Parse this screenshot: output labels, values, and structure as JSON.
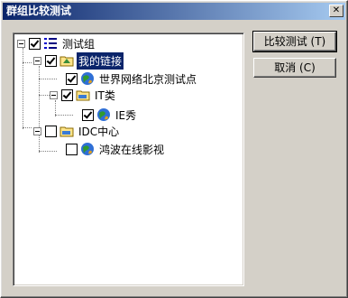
{
  "window": {
    "title": "群组比较测试",
    "close_glyph": "✕"
  },
  "tree": {
    "root": {
      "label": "测试组",
      "checked": true,
      "partial": true
    },
    "group1": {
      "label": "我的链接",
      "checked": true,
      "selected": true
    },
    "item1": {
      "label": "世界网络北京测试点",
      "checked": true
    },
    "group2": {
      "label": "IT类",
      "checked": true
    },
    "item2": {
      "label": "IE秀",
      "checked": true
    },
    "group3": {
      "label": "IDC中心",
      "checked": false
    },
    "item3": {
      "label": "鸿波在线影视",
      "checked": false
    }
  },
  "buttons": {
    "compare": "比较测试 (T)",
    "cancel": "取消 (C)"
  },
  "colors": {
    "title_start": "#0a246a",
    "title_end": "#a6caf0",
    "selection": "#0a246a",
    "face": "#d4d0c8"
  }
}
